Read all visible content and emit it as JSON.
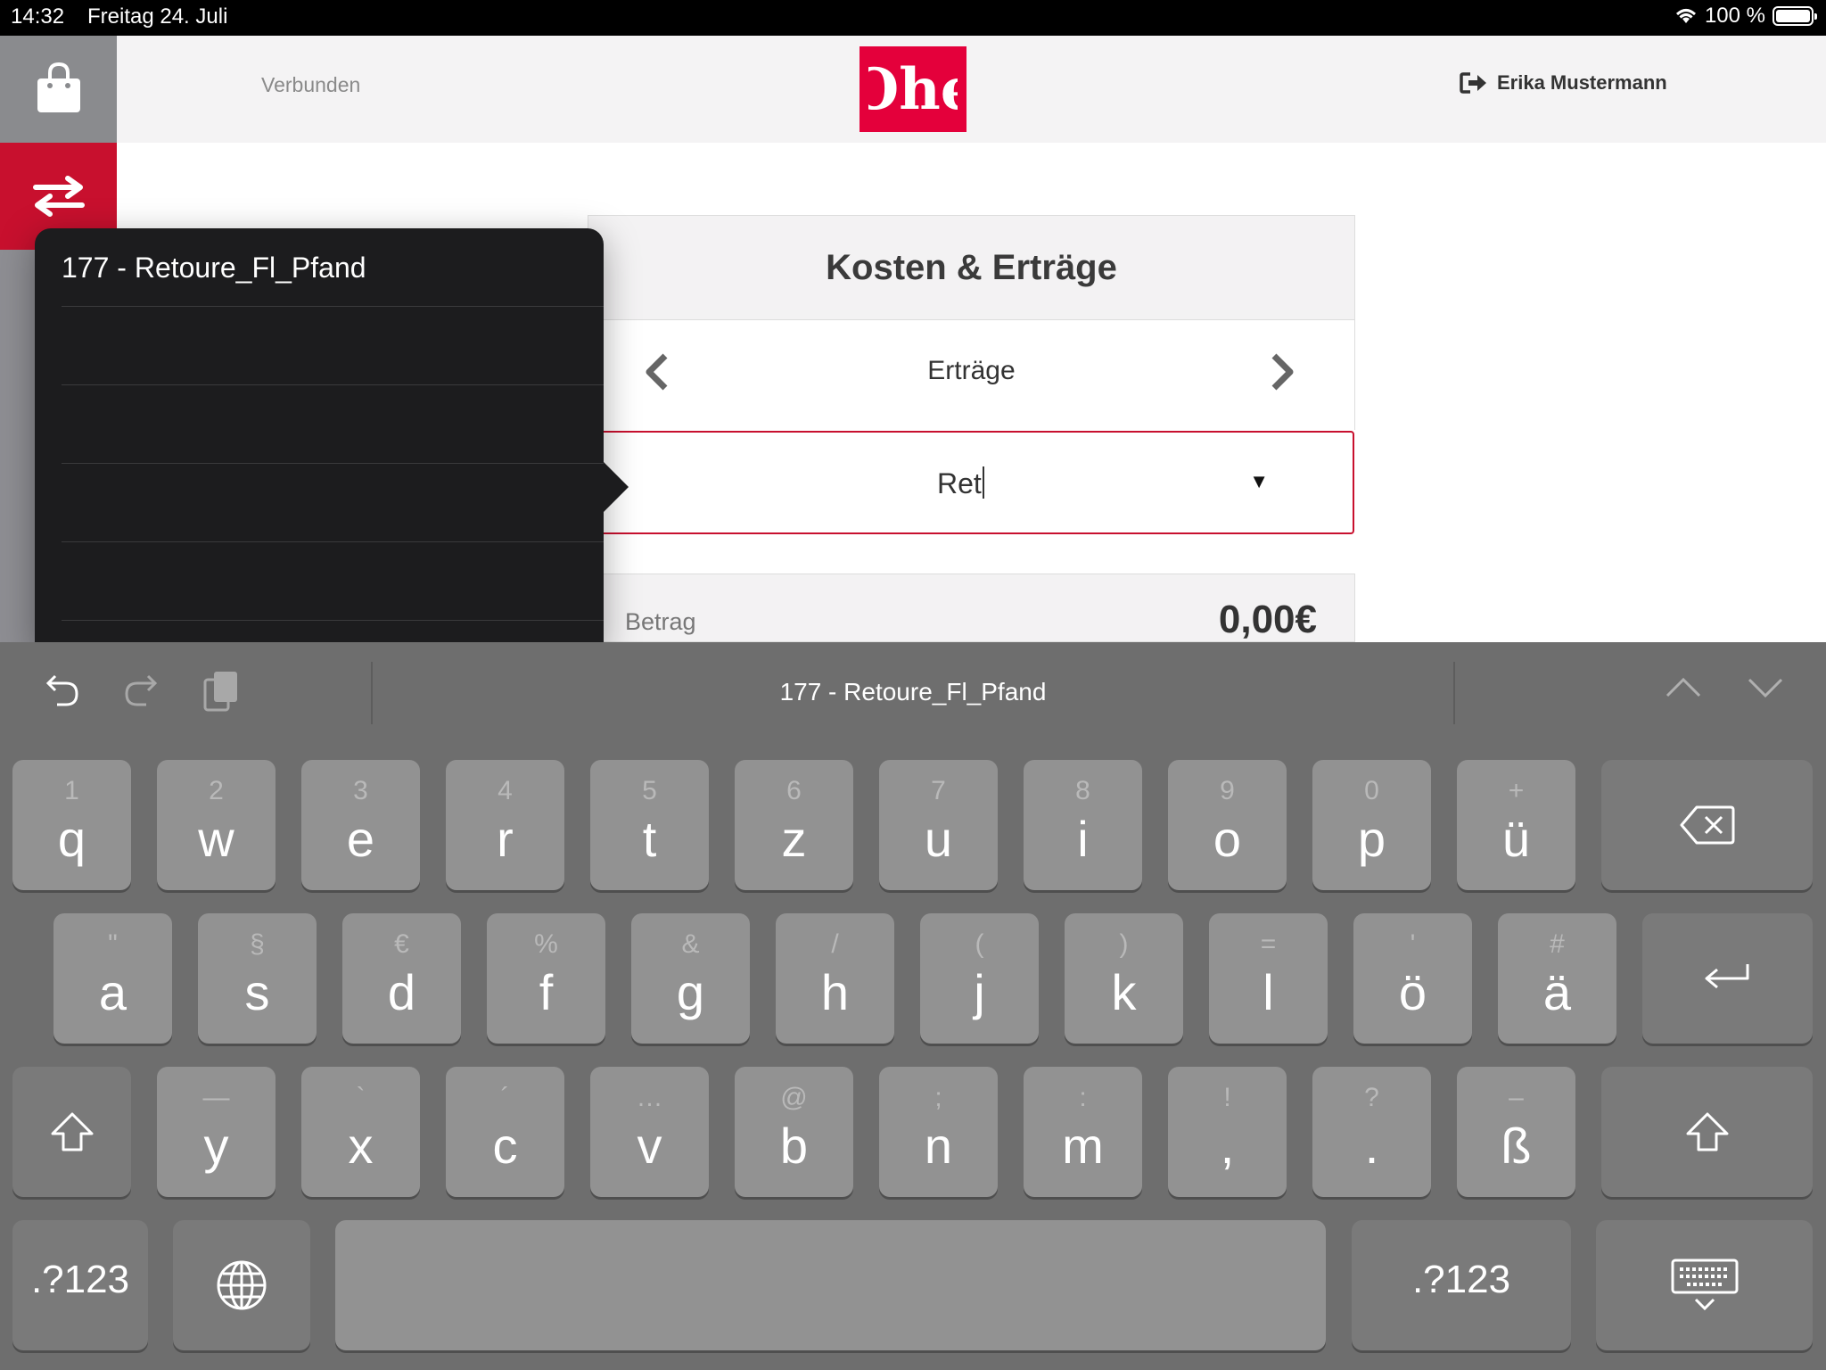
{
  "status_bar": {
    "time": "14:32",
    "date": "Freitag 24. Juli",
    "battery": "100 %",
    "battery_level": 1.0
  },
  "header": {
    "connection_status": "Verbunden",
    "user_name": "Erika Mustermann",
    "logo_text": "Ohe"
  },
  "card": {
    "title": "Kosten & Erträge",
    "category": "Erträge",
    "input_value": "Ret",
    "amount_label": "Betrag",
    "amount_value": "0,00€"
  },
  "popover": {
    "options": [
      "177 - Retoure_Fl_Pfand",
      "",
      "",
      "",
      ""
    ]
  },
  "keyboard": {
    "suggestion": "177 - Retoure_Fl_Pfand",
    "row1": [
      {
        "sec": "1",
        "pri": "q"
      },
      {
        "sec": "2",
        "pri": "w"
      },
      {
        "sec": "3",
        "pri": "e"
      },
      {
        "sec": "4",
        "pri": "r"
      },
      {
        "sec": "5",
        "pri": "t"
      },
      {
        "sec": "6",
        "pri": "z"
      },
      {
        "sec": "7",
        "pri": "u"
      },
      {
        "sec": "8",
        "pri": "i"
      },
      {
        "sec": "9",
        "pri": "o"
      },
      {
        "sec": "0",
        "pri": "p"
      },
      {
        "sec": "+",
        "pri": "ü"
      }
    ],
    "row2": [
      {
        "sec": "\"",
        "pri": "a"
      },
      {
        "sec": "§",
        "pri": "s"
      },
      {
        "sec": "€",
        "pri": "d"
      },
      {
        "sec": "%",
        "pri": "f"
      },
      {
        "sec": "&",
        "pri": "g"
      },
      {
        "sec": "/",
        "pri": "h"
      },
      {
        "sec": "(",
        "pri": "j"
      },
      {
        "sec": ")",
        "pri": "k"
      },
      {
        "sec": "=",
        "pri": "l"
      },
      {
        "sec": "'",
        "pri": "ö"
      },
      {
        "sec": "#",
        "pri": "ä"
      }
    ],
    "row3": [
      {
        "sec": "—",
        "pri": "y"
      },
      {
        "sec": "`",
        "pri": "x"
      },
      {
        "sec": "´",
        "pri": "c"
      },
      {
        "sec": "…",
        "pri": "v"
      },
      {
        "sec": "@",
        "pri": "b"
      },
      {
        "sec": ";",
        "pri": "n"
      },
      {
        "sec": ":",
        "pri": "m"
      },
      {
        "sec": "!",
        "pri": ","
      },
      {
        "sec": "?",
        "pri": "."
      },
      {
        "sec": "–",
        "pri": "ß"
      }
    ],
    "numbers_label": ".?123"
  },
  "colors": {
    "brand_red": "#c8102e",
    "logo_red": "#e4003b",
    "keyboard_bg": "#6e6e6e",
    "key_bg": "#929292"
  },
  "icons": [
    "shopping-bag-icon",
    "transfer-arrows-icon",
    "logout-icon",
    "chevron-left-icon",
    "chevron-right-icon",
    "dropdown-triangle-icon",
    "undo-icon",
    "redo-icon",
    "clipboard-icon",
    "chevron-up-icon",
    "chevron-down-icon",
    "delete-icon",
    "return-icon",
    "shift-icon",
    "globe-icon",
    "keyboard-dismiss-icon",
    "wifi-icon"
  ]
}
